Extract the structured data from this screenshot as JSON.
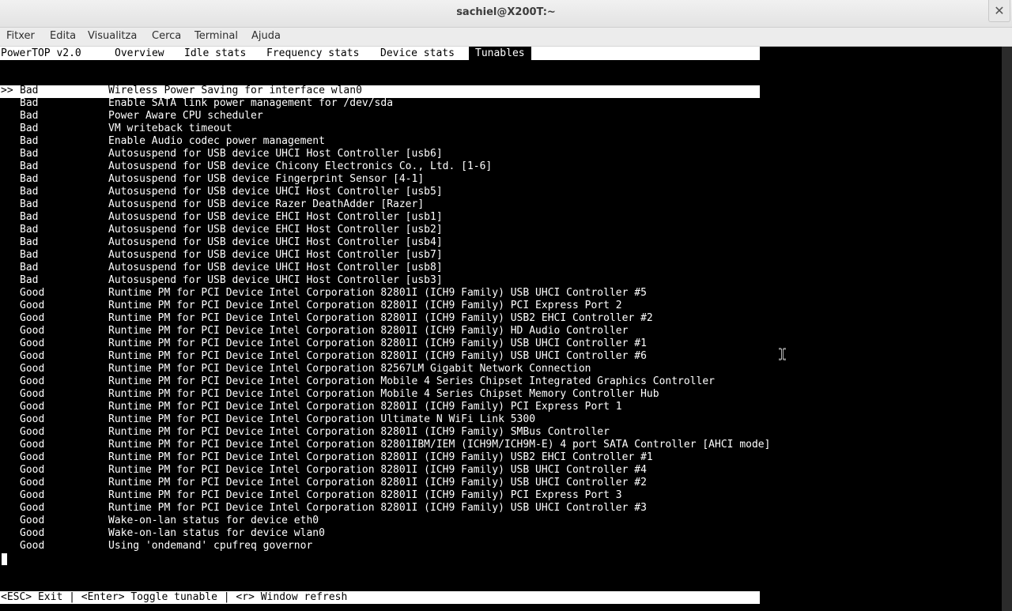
{
  "window": {
    "title": "sachiel@X200T:~",
    "close_glyph": "✕"
  },
  "menubar": {
    "items": [
      "Fitxer",
      "Edita",
      "Visualitza",
      "Cerca",
      "Terminal",
      "Ajuda"
    ]
  },
  "powertop": {
    "app_label": "PowerTOP v2.0",
    "tabs": [
      "Overview",
      "Idle stats",
      "Frequency stats",
      "Device stats",
      "Tunables"
    ],
    "active_tab": "Tunables",
    "selected_marker": ">>",
    "tunables": [
      {
        "status": "Bad",
        "name": "Wireless Power Saving for interface wlan0"
      },
      {
        "status": "Bad",
        "name": "Enable SATA link power management for /dev/sda"
      },
      {
        "status": "Bad",
        "name": "Power Aware CPU scheduler"
      },
      {
        "status": "Bad",
        "name": "VM writeback timeout"
      },
      {
        "status": "Bad",
        "name": "Enable Audio codec power management"
      },
      {
        "status": "Bad",
        "name": "Autosuspend for USB device UHCI Host Controller [usb6]"
      },
      {
        "status": "Bad",
        "name": "Autosuspend for USB device Chicony Electronics Co., Ltd. [1-6]"
      },
      {
        "status": "Bad",
        "name": "Autosuspend for USB device Fingerprint Sensor [4-1]"
      },
      {
        "status": "Bad",
        "name": "Autosuspend for USB device UHCI Host Controller [usb5]"
      },
      {
        "status": "Bad",
        "name": "Autosuspend for USB device Razer DeathAdder [Razer]"
      },
      {
        "status": "Bad",
        "name": "Autosuspend for USB device EHCI Host Controller [usb1]"
      },
      {
        "status": "Bad",
        "name": "Autosuspend for USB device EHCI Host Controller [usb2]"
      },
      {
        "status": "Bad",
        "name": "Autosuspend for USB device UHCI Host Controller [usb4]"
      },
      {
        "status": "Bad",
        "name": "Autosuspend for USB device UHCI Host Controller [usb7]"
      },
      {
        "status": "Bad",
        "name": "Autosuspend for USB device UHCI Host Controller [usb8]"
      },
      {
        "status": "Bad",
        "name": "Autosuspend for USB device UHCI Host Controller [usb3]"
      },
      {
        "status": "Good",
        "name": "Runtime PM for PCI Device Intel Corporation 82801I (ICH9 Family) USB UHCI Controller #5"
      },
      {
        "status": "Good",
        "name": "Runtime PM for PCI Device Intel Corporation 82801I (ICH9 Family) PCI Express Port 2"
      },
      {
        "status": "Good",
        "name": "Runtime PM for PCI Device Intel Corporation 82801I (ICH9 Family) USB2 EHCI Controller #2"
      },
      {
        "status": "Good",
        "name": "Runtime PM for PCI Device Intel Corporation 82801I (ICH9 Family) HD Audio Controller"
      },
      {
        "status": "Good",
        "name": "Runtime PM for PCI Device Intel Corporation 82801I (ICH9 Family) USB UHCI Controller #1"
      },
      {
        "status": "Good",
        "name": "Runtime PM for PCI Device Intel Corporation 82801I (ICH9 Family) USB UHCI Controller #6"
      },
      {
        "status": "Good",
        "name": "Runtime PM for PCI Device Intel Corporation 82567LM Gigabit Network Connection"
      },
      {
        "status": "Good",
        "name": "Runtime PM for PCI Device Intel Corporation Mobile 4 Series Chipset Integrated Graphics Controller"
      },
      {
        "status": "Good",
        "name": "Runtime PM for PCI Device Intel Corporation Mobile 4 Series Chipset Memory Controller Hub"
      },
      {
        "status": "Good",
        "name": "Runtime PM for PCI Device Intel Corporation 82801I (ICH9 Family) PCI Express Port 1"
      },
      {
        "status": "Good",
        "name": "Runtime PM for PCI Device Intel Corporation Ultimate N WiFi Link 5300"
      },
      {
        "status": "Good",
        "name": "Runtime PM for PCI Device Intel Corporation 82801I (ICH9 Family) SMBus Controller"
      },
      {
        "status": "Good",
        "name": "Runtime PM for PCI Device Intel Corporation 82801IBM/IEM (ICH9M/ICH9M-E) 4 port SATA Controller [AHCI mode]"
      },
      {
        "status": "Good",
        "name": "Runtime PM for PCI Device Intel Corporation 82801I (ICH9 Family) USB2 EHCI Controller #1"
      },
      {
        "status": "Good",
        "name": "Runtime PM for PCI Device Intel Corporation 82801I (ICH9 Family) USB UHCI Controller #4"
      },
      {
        "status": "Good",
        "name": "Runtime PM for PCI Device Intel Corporation 82801I (ICH9 Family) USB UHCI Controller #2"
      },
      {
        "status": "Good",
        "name": "Runtime PM for PCI Device Intel Corporation 82801I (ICH9 Family) PCI Express Port 3"
      },
      {
        "status": "Good",
        "name": "Runtime PM for PCI Device Intel Corporation 82801I (ICH9 Family) USB UHCI Controller #3"
      },
      {
        "status": "Good",
        "name": "Wake-on-lan status for device eth0"
      },
      {
        "status": "Good",
        "name": "Wake-on-lan status for device wlan0"
      },
      {
        "status": "Good",
        "name": "Using 'ondemand' cpufreq governor"
      }
    ],
    "footer": "<ESC> Exit | <Enter> Toggle tunable | <r> Window refresh"
  },
  "colors": {
    "terminal_bg": "#000000",
    "terminal_fg": "#ffffff",
    "chrome_bg": "#ececec"
  }
}
